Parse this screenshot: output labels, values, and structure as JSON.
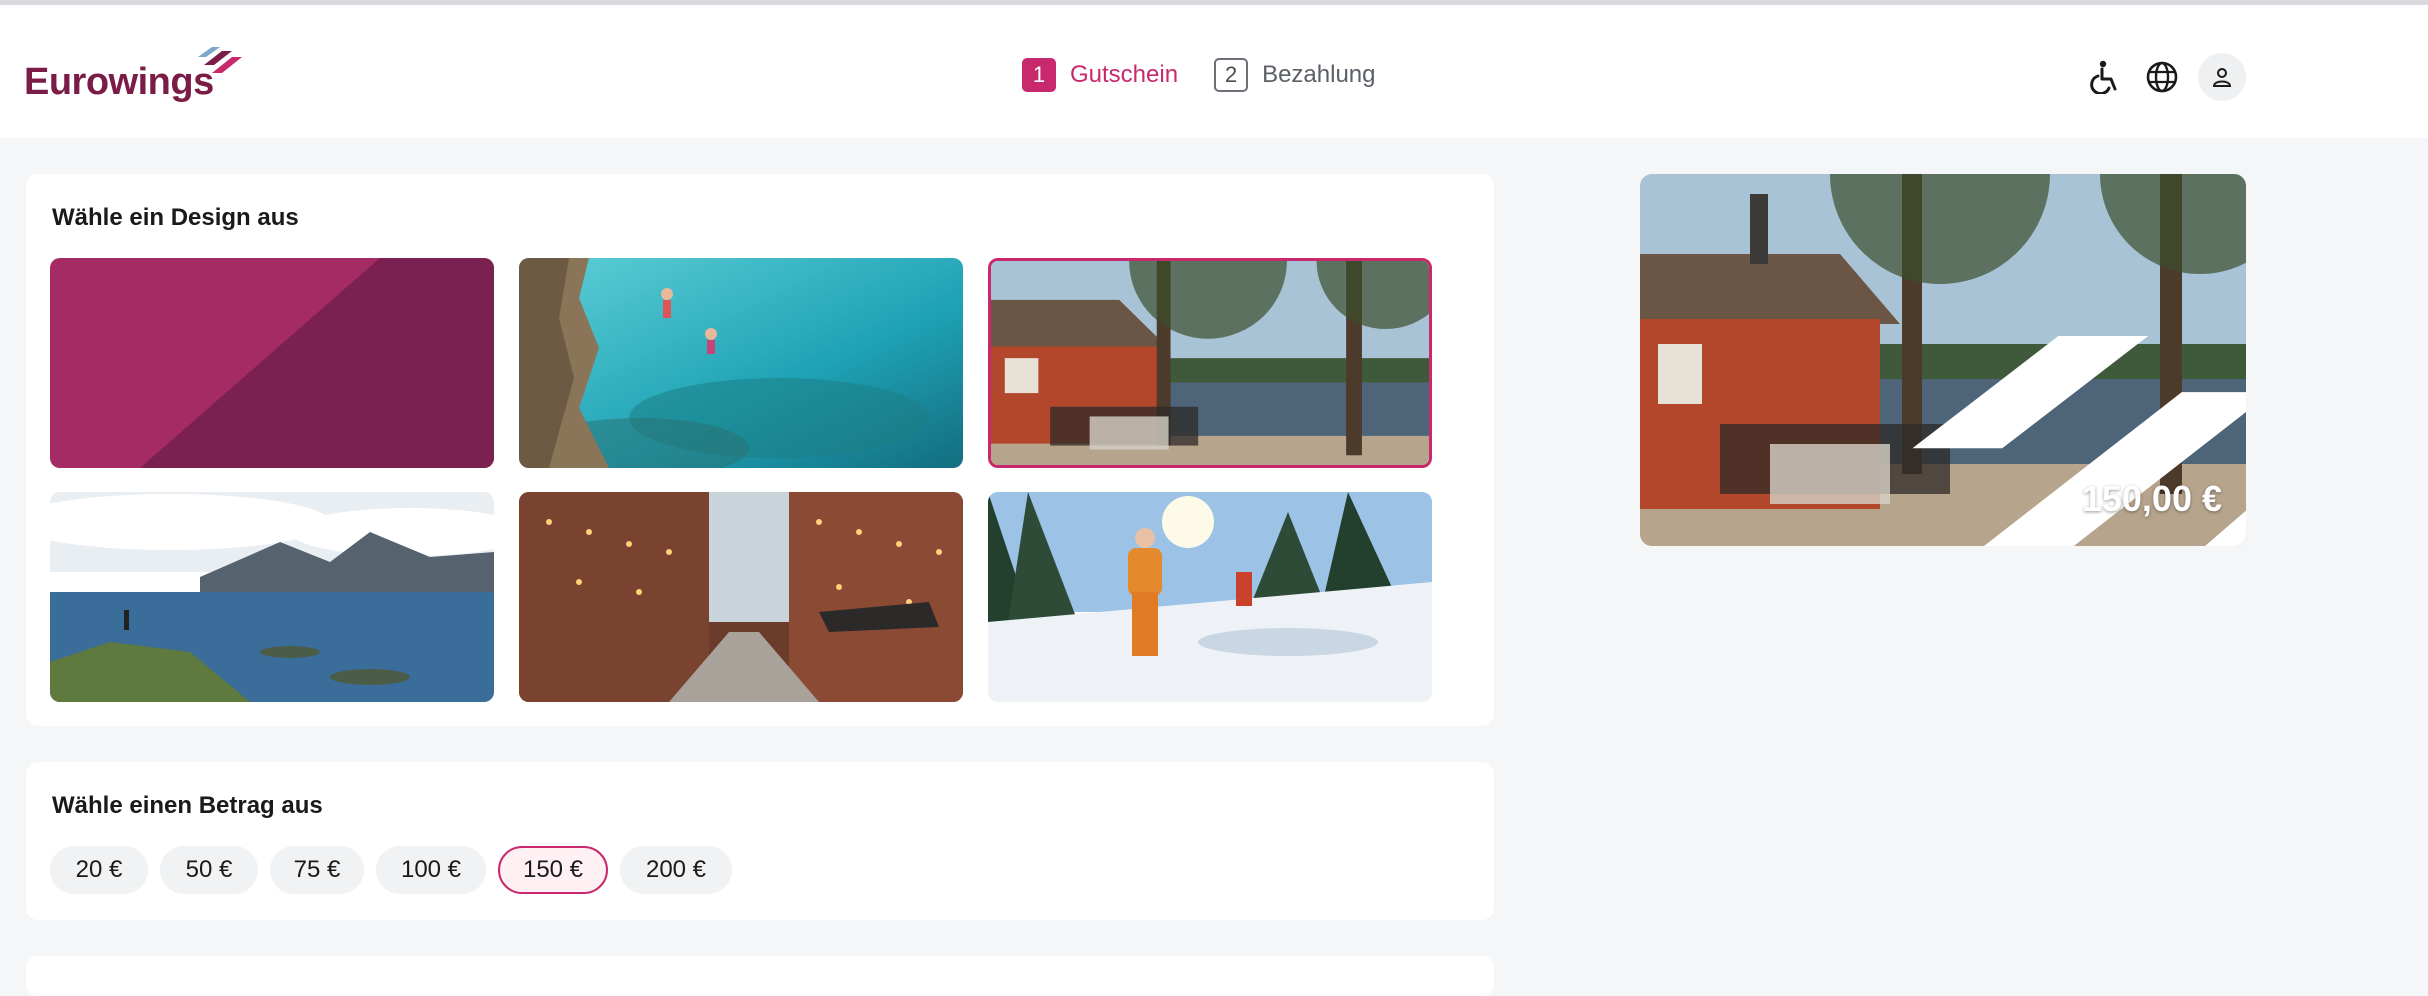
{
  "brand": {
    "name": "Eurowings",
    "color": "#7b1c48",
    "accent": "#c8296c"
  },
  "steps": [
    {
      "number": "1",
      "label": "Gutschein",
      "state": "active"
    },
    {
      "number": "2",
      "label": "Bezahlung",
      "state": "inactive"
    }
  ],
  "header_icons": [
    "accessibility-icon",
    "globe-icon",
    "user-icon"
  ],
  "design_section": {
    "title": "Wähle ein Design aus",
    "designs": [
      "plain-magenta",
      "cliff-jump-sea",
      "red-cabin-lake",
      "mountain-fjord",
      "brick-street-lights",
      "snow-ski-touring"
    ],
    "selected_index": 2
  },
  "amount_section": {
    "title": "Wähle einen Betrag aus",
    "amounts": [
      "20 €",
      "50 €",
      "75 €",
      "100 €",
      "150 €",
      "200 €"
    ],
    "selected_index": 4
  },
  "preview": {
    "amount": "150,00 €",
    "design": "red-cabin-lake"
  }
}
